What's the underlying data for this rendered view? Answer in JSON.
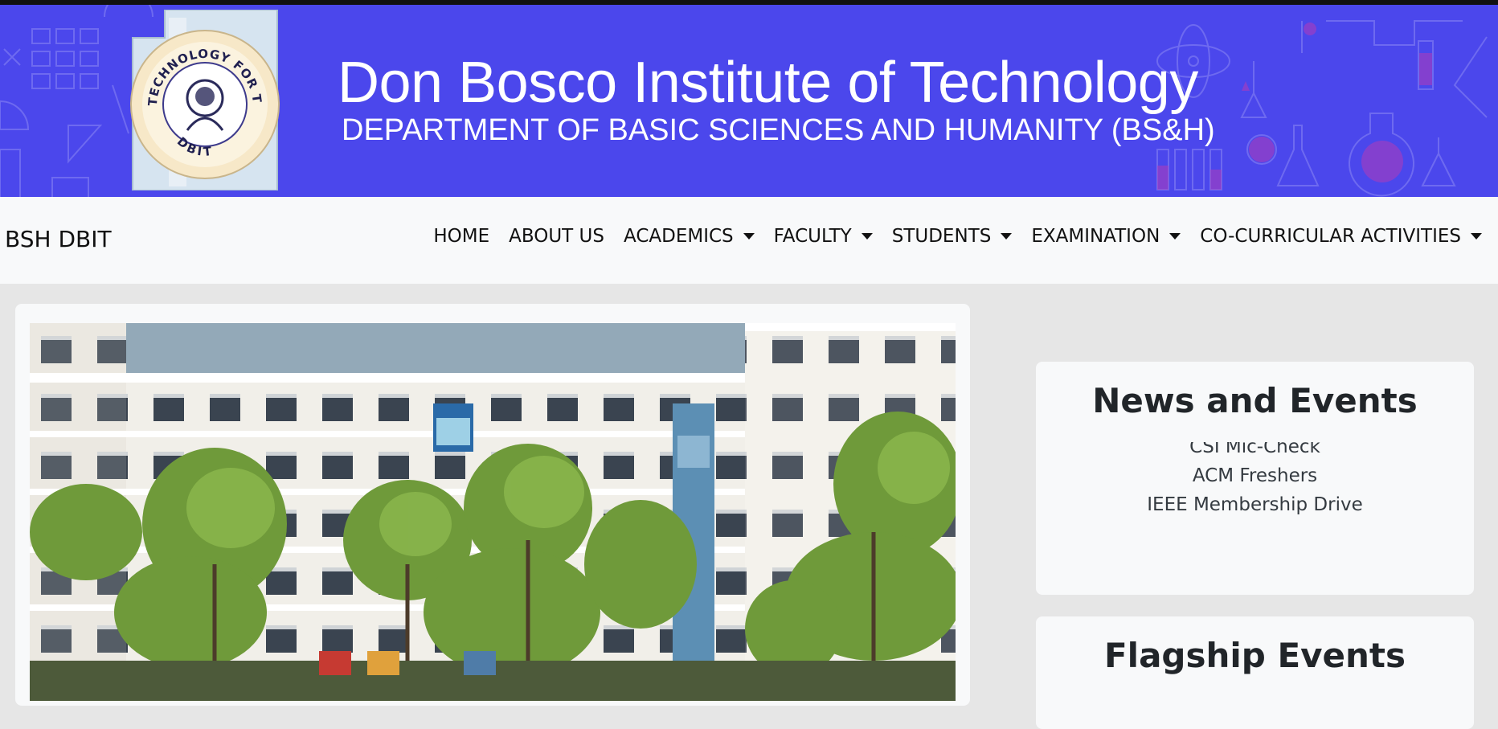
{
  "banner": {
    "title": "Don Bosco Institute of Technology",
    "subtitle": "DEPARTMENT OF BASIC SCIENCES AND HUMANITY (BS&H)",
    "logo": {
      "top_text": "TECHNOLOGY FOR THE YOUNG",
      "bottom_text": "DBIT"
    },
    "colors": {
      "background": "#4b47ec",
      "text": "#ffffff"
    }
  },
  "navbar": {
    "brand": "BSH DBIT",
    "items": [
      {
        "label": "HOME",
        "dropdown": false
      },
      {
        "label": "ABOUT US",
        "dropdown": false
      },
      {
        "label": "ACADEMICS",
        "dropdown": true
      },
      {
        "label": "FACULTY",
        "dropdown": true
      },
      {
        "label": "STUDENTS",
        "dropdown": true
      },
      {
        "label": "EXAMINATION",
        "dropdown": true
      },
      {
        "label": "CO-CURRICULAR ACTIVITIES",
        "dropdown": true
      }
    ]
  },
  "news": {
    "title": "News and Events",
    "items": [
      "CSI Mic-Check",
      "ACM Freshers",
      "IEEE Membership Drive"
    ]
  },
  "flagship": {
    "title": "Flagship Events"
  }
}
